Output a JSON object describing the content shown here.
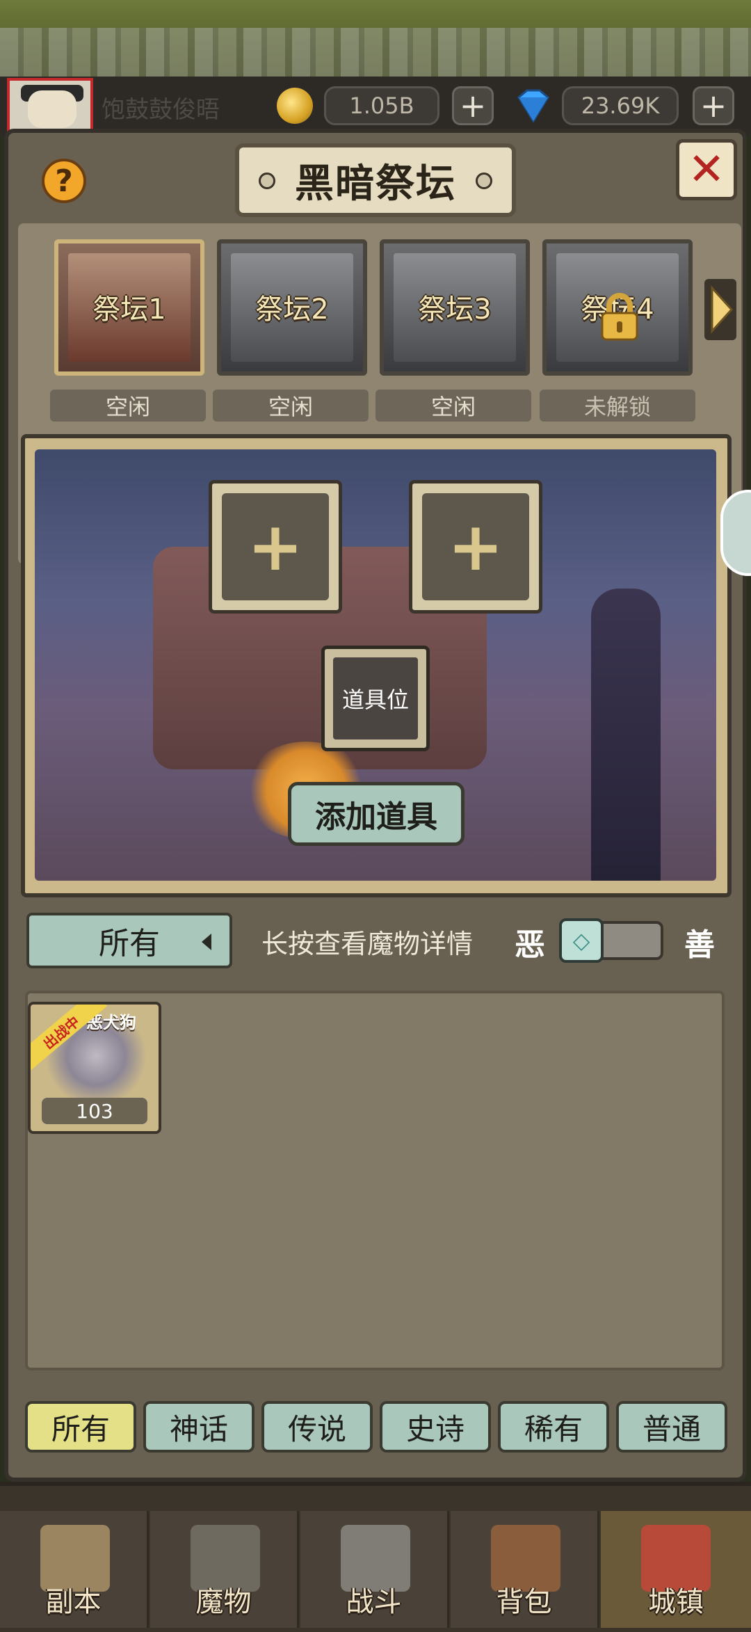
{
  "topbar": {
    "player_name": "饱鼓鼓俊晤",
    "gold": "1.05B",
    "gems": "23.69K",
    "plus": "+"
  },
  "dialog": {
    "title": "黑暗祭坛",
    "help": "?",
    "close": "✕"
  },
  "altars": [
    {
      "label": "祭坛1",
      "status": "空闲"
    },
    {
      "label": "祭坛2",
      "status": "空闲"
    },
    {
      "label": "祭坛3",
      "status": "空闲"
    },
    {
      "label": "祭坛4",
      "status": "未解锁"
    }
  ],
  "scene": {
    "slot_plus": "+",
    "item_slot": "道具位",
    "add_item": "添加道具"
  },
  "filter": {
    "selected": "所有",
    "hint": "长按查看魔物详情",
    "evil": "恶",
    "good": "善"
  },
  "monsters": [
    {
      "name": "恶犬狗",
      "badge": "出战中",
      "level": "103"
    }
  ],
  "rarity_tabs": [
    "所有",
    "神话",
    "传说",
    "史诗",
    "稀有",
    "普通"
  ],
  "nav": [
    "副本",
    "魔物",
    "战斗",
    "背包",
    "城镇"
  ],
  "colors": {
    "accent_teal": "#a9c7bb",
    "selected_yellow": "#e4e088",
    "close_red": "#b3231f"
  }
}
